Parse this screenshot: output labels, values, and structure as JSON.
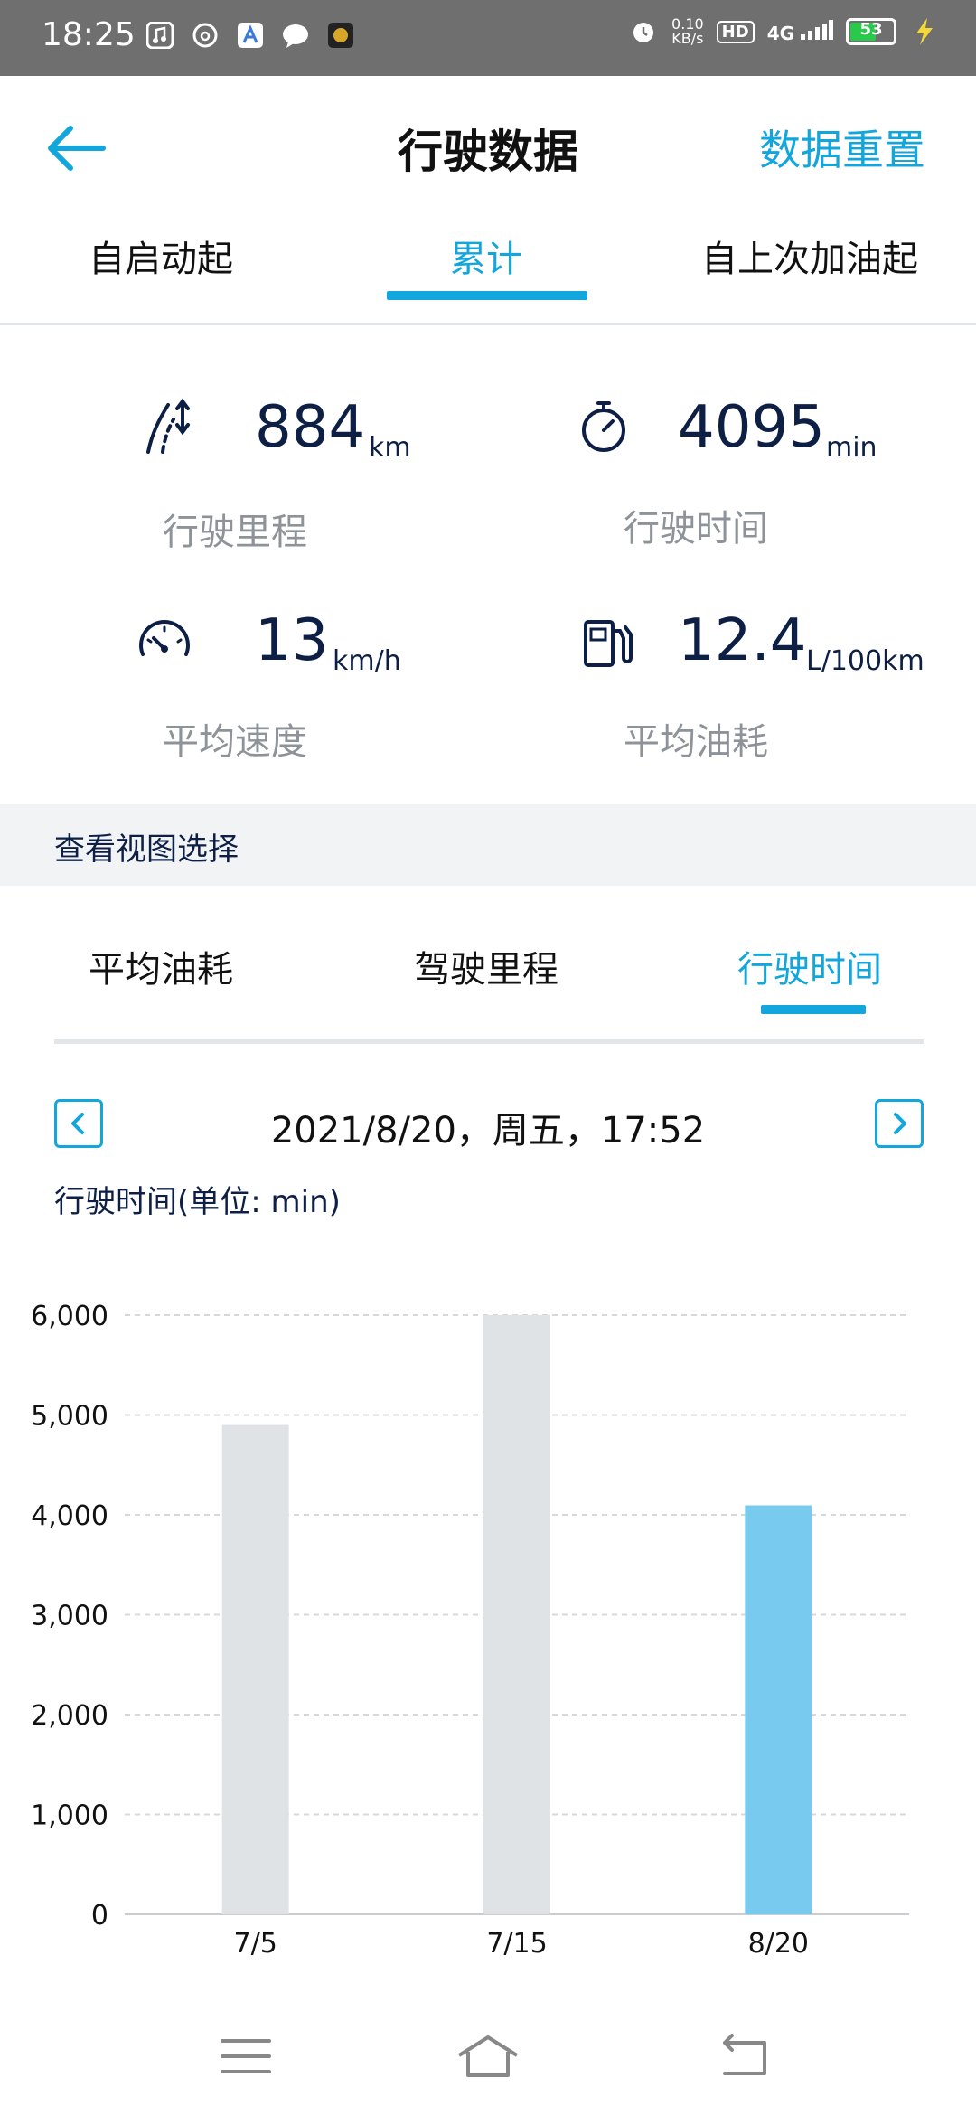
{
  "status_bar": {
    "time": "18:25",
    "speed": "0.10",
    "speed_unit": "KB/s",
    "hd": "HD",
    "network": "4G",
    "battery": "53"
  },
  "header": {
    "title": "行驶数据",
    "reset_label": "数据重置"
  },
  "top_tabs": [
    "自启动起",
    "累计",
    "自上次加油起"
  ],
  "stats": {
    "distance": {
      "value": "884",
      "unit": "km",
      "label": "行驶里程",
      "icon": "road-icon"
    },
    "time": {
      "value": "4095",
      "unit": "min",
      "label": "行驶时间",
      "icon": "stopwatch-icon"
    },
    "speed": {
      "value": "13",
      "unit": "km/h",
      "label": "平均速度",
      "icon": "speedometer-icon"
    },
    "fuel": {
      "value": "12.4",
      "unit": "L/100km",
      "label": "平均油耗",
      "icon": "fuel-pump-icon"
    }
  },
  "view_section": {
    "title": "查看视图选择"
  },
  "chart_tabs": [
    "平均油耗",
    "驾驶里程",
    "行驶时间"
  ],
  "date_nav": {
    "date": "2021/8/20，周五，17:52"
  },
  "chart_unit_label": "行驶时间(单位: min)",
  "colors": {
    "accent": "#13a6dd",
    "bar_default": "#dfe3e6",
    "bar_highlight": "#78cbef",
    "navy": "#0e1f45"
  },
  "chart_data": {
    "type": "bar",
    "categories": [
      "7/5",
      "7/15",
      "8/20"
    ],
    "values": [
      4900,
      6000,
      4095
    ],
    "highlight_index": 2,
    "ylim": [
      0,
      6000
    ],
    "yticks": [
      0,
      1000,
      2000,
      3000,
      4000,
      5000,
      6000
    ],
    "ytick_labels": [
      "0",
      "1,000",
      "2,000",
      "3,000",
      "4,000",
      "5,000",
      "6,000"
    ],
    "grid": true,
    "title": "",
    "xlabel": "",
    "ylabel": ""
  }
}
